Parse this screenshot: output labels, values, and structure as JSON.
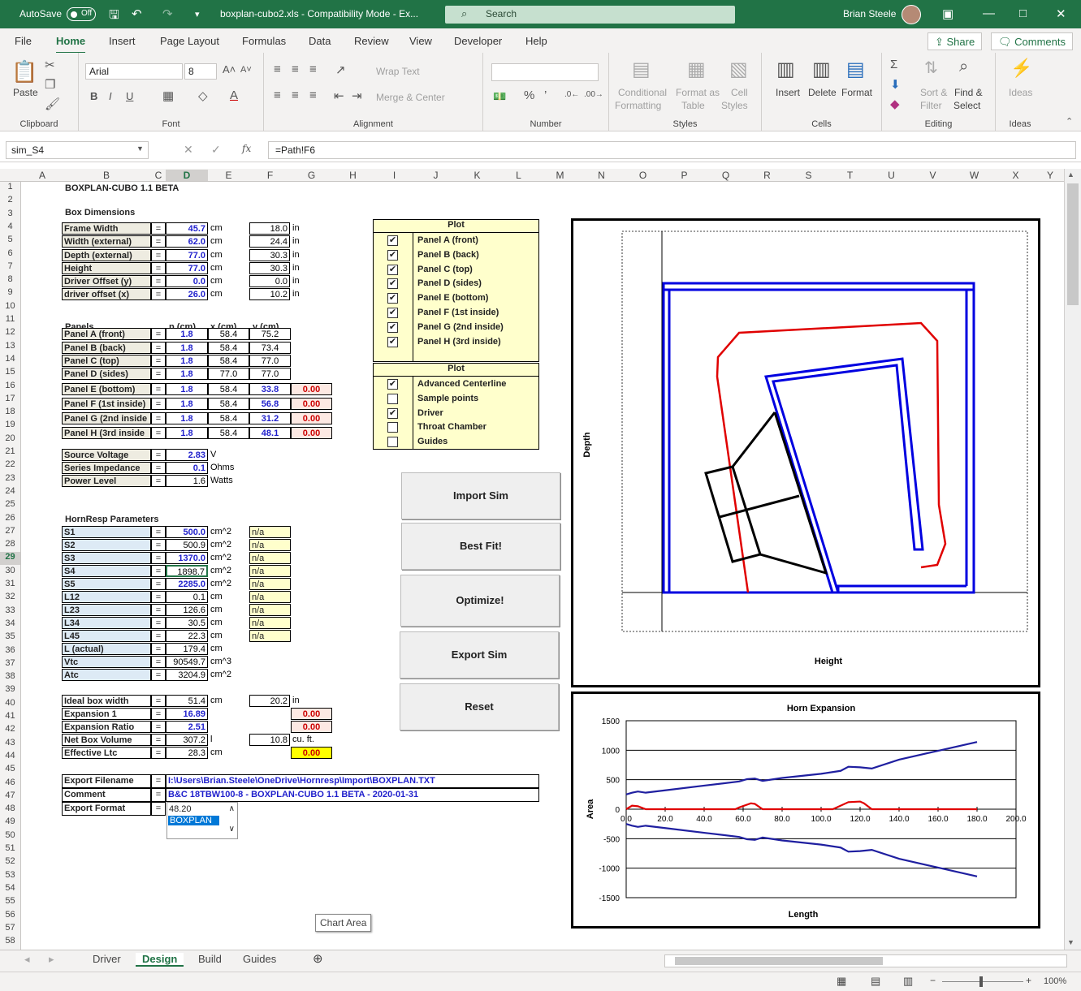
{
  "titlebar": {
    "autosave": "AutoSave",
    "autosave_state": "Off",
    "filename": "boxplan-cubo2.xls  -  Compatibility Mode  -  Ex...",
    "search_placeholder": "Search",
    "user": "Brian Steele"
  },
  "menu": [
    "File",
    "Home",
    "Insert",
    "Page Layout",
    "Formulas",
    "Data",
    "Review",
    "View",
    "Developer",
    "Help"
  ],
  "share": "Share",
  "comments": "Comments",
  "ribbon": {
    "clipboard": {
      "label": "Clipboard",
      "paste": "Paste"
    },
    "font": {
      "label": "Font",
      "name": "Arial",
      "size": "8"
    },
    "alignment": {
      "label": "Alignment",
      "wrap": "Wrap Text",
      "merge": "Merge & Center"
    },
    "number": {
      "label": "Number"
    },
    "styles": {
      "label": "Styles",
      "cond1": "Conditional",
      "cond2": "Formatting",
      "fmt1": "Format as",
      "fmt2": "Table",
      "cell1": "Cell",
      "cell2": "Styles"
    },
    "cells": {
      "label": "Cells",
      "insert": "Insert",
      "delete": "Delete",
      "format": "Format"
    },
    "editing": {
      "label": "Editing",
      "sort1": "Sort &",
      "sort2": "Filter",
      "find1": "Find &",
      "find2": "Select"
    },
    "ideas": {
      "label": "Ideas",
      "btn": "Ideas"
    }
  },
  "formula": {
    "namebox": "sim_S4",
    "fx": "fx",
    "content": "=Path!F6"
  },
  "columns": [
    "A",
    "B",
    "C",
    "D",
    "E",
    "F",
    "G",
    "H",
    "I",
    "J",
    "K",
    "L",
    "M",
    "N",
    "O",
    "P",
    "Q",
    "R",
    "S",
    "T",
    "U",
    "V",
    "W",
    "X",
    "Y"
  ],
  "rows": [
    "1",
    "2",
    "3",
    "4",
    "5",
    "6",
    "7",
    "8",
    "9",
    "10",
    "11",
    "12",
    "13",
    "14",
    "15",
    "16",
    "17",
    "18",
    "19",
    "20",
    "21",
    "22",
    "23",
    "24",
    "25",
    "26",
    "27",
    "28",
    "29",
    "30",
    "31",
    "32",
    "33",
    "34",
    "35",
    "36",
    "37",
    "38",
    "39",
    "40",
    "41",
    "42",
    "43",
    "44",
    "45",
    "46",
    "47",
    "48",
    "49",
    "50",
    "51",
    "52",
    "53",
    "54",
    "55",
    "56",
    "57",
    "58"
  ],
  "sheet": {
    "title": "BOXPLAN-CUBO 1.1 BETA",
    "box_header": "Box Dimensions",
    "box": [
      {
        "label": "Frame Width",
        "v": "45.7",
        "u": "cm",
        "in": "18.0",
        "iu": "in"
      },
      {
        "label": "Width (external)",
        "v": "62.0",
        "u": "cm",
        "in": "24.4",
        "iu": "in"
      },
      {
        "label": "Depth (external)",
        "v": "77.0",
        "u": "cm",
        "in": "30.3",
        "iu": "in"
      },
      {
        "label": "Height",
        "v": "77.0",
        "u": "cm",
        "in": "30.3",
        "iu": "in"
      },
      {
        "label": "Driver Offset (y)",
        "v": "0.0",
        "u": "cm",
        "in": "0.0",
        "iu": "in"
      },
      {
        "label": "driver offset (x)",
        "v": "26.0",
        "u": "cm",
        "in": "10.2",
        "iu": "in"
      }
    ],
    "eq": "=",
    "panels_header": "Panels",
    "p_hdr": "p (cm)",
    "x_hdr": "x (cm)",
    "y_hdr": "y (cm)",
    "panels": [
      {
        "label": "Panel A (front)",
        "p": "1.8",
        "x": "58.4",
        "y": "75.2",
        "e": ""
      },
      {
        "label": "Panel B (back)",
        "p": "1.8",
        "x": "58.4",
        "y": "73.4",
        "e": ""
      },
      {
        "label": "Panel C (top)",
        "p": "1.8",
        "x": "58.4",
        "y": "77.0",
        "e": ""
      },
      {
        "label": "Panel D (sides)",
        "p": "1.8",
        "x": "77.0",
        "y": "77.0",
        "e": ""
      },
      {
        "label": "Panel E (bottom)",
        "p": "1.8",
        "x": "58.4",
        "y": "33.8",
        "e": "0.00"
      },
      {
        "label": "Panel F (1st inside)",
        "p": "1.8",
        "x": "58.4",
        "y": "56.8",
        "e": "0.00"
      },
      {
        "label": "Panel G (2nd inside",
        "p": "1.8",
        "x": "58.4",
        "y": "31.2",
        "e": "0.00"
      },
      {
        "label": "Panel H (3rd inside",
        "p": "1.8",
        "x": "58.4",
        "y": "48.1",
        "e": "0.00"
      }
    ],
    "source": [
      {
        "label": "Source Voltage",
        "v": "2.83",
        "u": "V"
      },
      {
        "label": "Series Impedance",
        "v": "0.1",
        "u": "Ohms"
      },
      {
        "label": "Power Level",
        "v": "1.6",
        "u": "Watts"
      }
    ],
    "hr_header": "HornResp Parameters",
    "hr": [
      {
        "label": "S1",
        "v": "500.0",
        "u": "cm^2",
        "na": "n/a"
      },
      {
        "label": "S2",
        "v": "500.9",
        "u": "cm^2",
        "na": "n/a"
      },
      {
        "label": "S3",
        "v": "1370.0",
        "u": "cm^2",
        "na": "n/a"
      },
      {
        "label": "S4",
        "v": "1898.7",
        "u": "cm^2",
        "na": "n/a"
      },
      {
        "label": "S5",
        "v": "2285.0",
        "u": "cm^2",
        "na": "n/a"
      },
      {
        "label": "L12",
        "v": "0.1",
        "u": "cm",
        "na": "n/a"
      },
      {
        "label": "L23",
        "v": "126.6",
        "u": "cm",
        "na": "n/a"
      },
      {
        "label": "L34",
        "v": "30.5",
        "u": "cm",
        "na": "n/a"
      },
      {
        "label": "L45",
        "v": "22.3",
        "u": "cm",
        "na": "n/a"
      },
      {
        "label": "L (actual)",
        "v": "179.4",
        "u": "cm",
        "na": ""
      },
      {
        "label": "Vtc",
        "v": "90549.7",
        "u": "cm^3",
        "na": ""
      },
      {
        "label": "Atc",
        "v": "3204.9",
        "u": "cm^2",
        "na": ""
      }
    ],
    "ideal": [
      {
        "label": "Ideal box width",
        "v": "51.4",
        "u": "cm"
      },
      {
        "label": "Expansion 1",
        "v": "16.89",
        "u": ""
      },
      {
        "label": "Expansion Ratio",
        "v": "2.51",
        "u": ""
      },
      {
        "label": "Net Box Volume",
        "v": "307.2",
        "u": "l"
      },
      {
        "label": "Effective Ltc",
        "v": "28.3",
        "u": "cm"
      }
    ],
    "ideal_in": "20.2",
    "ideal_in_u": "in",
    "exp1_g": "0.00",
    "ratio_g": "0.00",
    "netbox_cuft": "10.8",
    "netbox_cuft_u": "cu. ft.",
    "ltc_g": "0.00",
    "export": [
      {
        "label": "Export Filename",
        "v": "I:\\Users\\Brian.Steele\\OneDrive\\Hornresp\\Import\\BOXPLAN.TXT"
      },
      {
        "label": "Comment",
        "v": "B&C 18TBW100-8 - BOXPLAN-CUBO 1.1 BETA - 2020-01-31"
      },
      {
        "label": "Export Format",
        "v": ""
      }
    ],
    "format_options": [
      "48.20",
      "BOXPLAN"
    ],
    "plot1_header": "Plot",
    "plot1": [
      {
        "label": "Panel A (front)",
        "checked": true
      },
      {
        "label": "Panel B (back)",
        "checked": true
      },
      {
        "label": "Panel C (top)",
        "checked": true
      },
      {
        "label": "Panel D (sides)",
        "checked": true
      },
      {
        "label": "Panel E (bottom)",
        "checked": true
      },
      {
        "label": "Panel F (1st inside)",
        "checked": true
      },
      {
        "label": "Panel G (2nd inside)",
        "checked": true
      },
      {
        "label": "Panel H (3rd inside)",
        "checked": true
      }
    ],
    "plot2_header": "Plot",
    "plot2": [
      {
        "label": "Advanced Centerline",
        "checked": true
      },
      {
        "label": "Sample points",
        "checked": false
      },
      {
        "label": "Driver",
        "checked": true
      },
      {
        "label": "Throat Chamber",
        "checked": false
      },
      {
        "label": "Guides",
        "checked": false
      }
    ],
    "buttons": [
      "Import Sim",
      "Best Fit!",
      "Optimize!",
      "Export Sim",
      "Reset"
    ],
    "tooltip": "Chart Area"
  },
  "chart1": {
    "xlabel": "Height",
    "ylabel": "Depth"
  },
  "chart_data": {
    "type": "line",
    "title": "Horn Expansion",
    "xlabel": "Length",
    "ylabel": "Area",
    "xlim": [
      0,
      200
    ],
    "ylim": [
      -1500,
      1500
    ],
    "xticks": [
      "0.0",
      "20.0",
      "40.0",
      "60.0",
      "80.0",
      "100.0",
      "120.0",
      "140.0",
      "160.0",
      "180.0",
      "200.0"
    ],
    "yticks": [
      "1500",
      "1000",
      "500",
      "0",
      "-500",
      "-1000",
      "-1500"
    ],
    "series": [
      {
        "color": "#1f1fa0",
        "x": [
          0,
          3,
          6,
          10,
          20,
          40,
          58,
          62,
          66,
          70,
          80,
          100,
          110,
          114,
          120,
          126,
          140,
          160,
          180
        ],
        "values": [
          250,
          280,
          300,
          280,
          320,
          400,
          470,
          510,
          520,
          480,
          530,
          600,
          650,
          720,
          710,
          690,
          840,
          990,
          1140
        ]
      },
      {
        "color": "#1f1fa0",
        "x": [
          0,
          3,
          6,
          10,
          20,
          40,
          58,
          62,
          66,
          70,
          80,
          100,
          110,
          114,
          120,
          126,
          140,
          160,
          180
        ],
        "values": [
          -250,
          -280,
          -300,
          -280,
          -320,
          -400,
          -470,
          -510,
          -520,
          -480,
          -530,
          -600,
          -650,
          -720,
          -710,
          -690,
          -840,
          -990,
          -1140
        ]
      },
      {
        "color": "#e00000",
        "x": [
          0,
          3,
          6,
          10,
          20,
          56,
          58,
          64,
          66,
          70,
          106,
          108,
          114,
          120,
          122,
          126,
          140,
          180
        ],
        "values": [
          0,
          60,
          50,
          0,
          0,
          0,
          30,
          100,
          90,
          0,
          0,
          30,
          120,
          130,
          100,
          0,
          0,
          0
        ]
      }
    ]
  },
  "tabs": [
    "Driver",
    "Design",
    "Build",
    "Guides"
  ],
  "status": {
    "zoom": "100%"
  }
}
